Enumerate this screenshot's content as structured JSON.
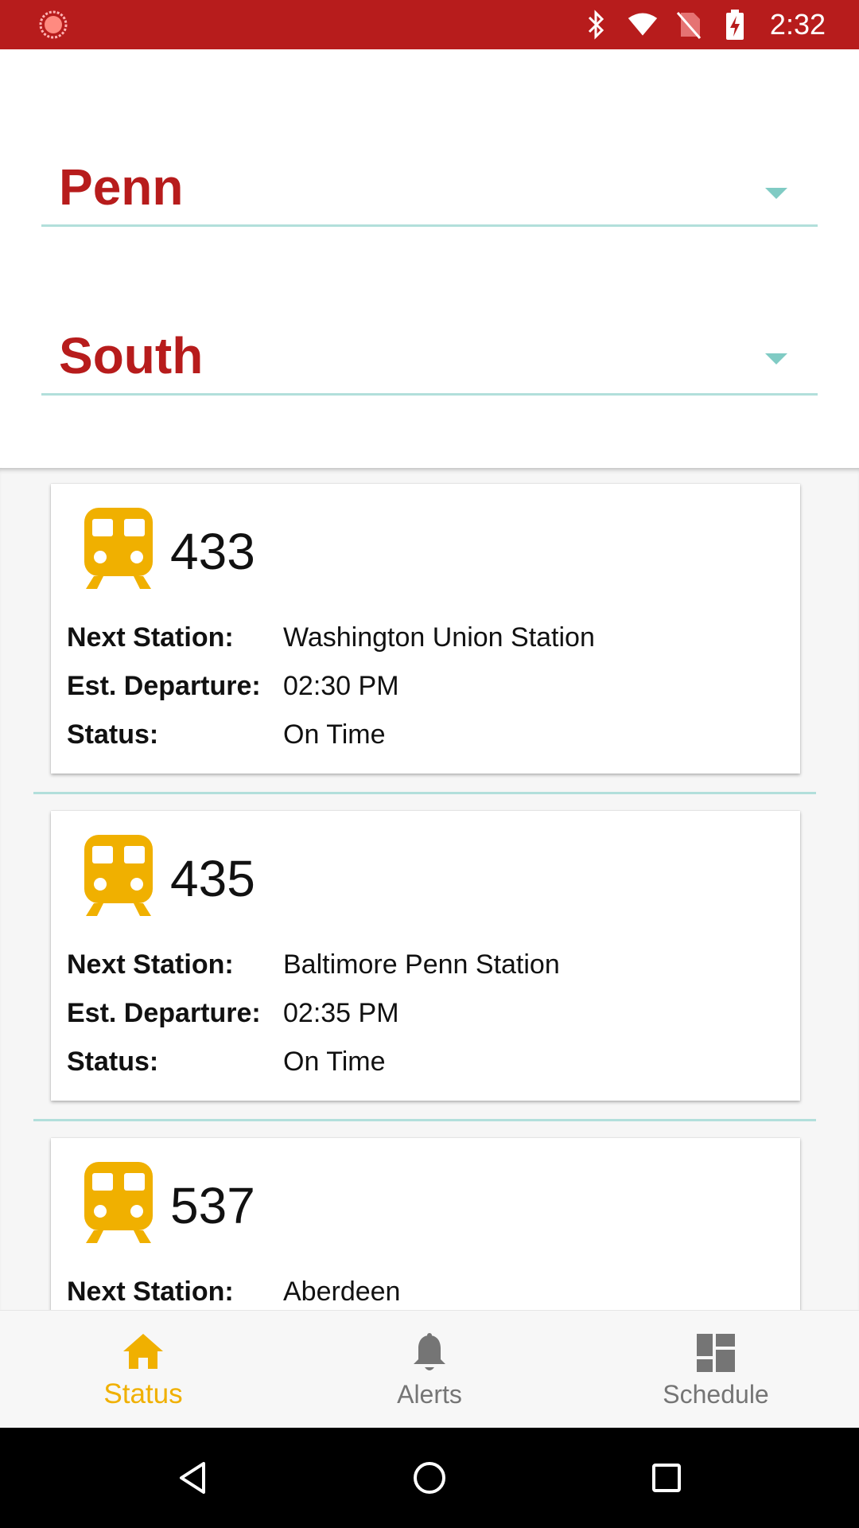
{
  "status_bar": {
    "time": "2:32",
    "icons": [
      "app-notification-icon",
      "bluetooth-icon",
      "wifi-icon",
      "no-sim-icon",
      "battery-charging-icon"
    ]
  },
  "selectors": {
    "station": {
      "value": "Penn"
    },
    "direction": {
      "value": "South"
    }
  },
  "labels": {
    "next_station": "Next Station:",
    "est_departure": "Est. Departure:",
    "status": "Status:"
  },
  "trains": [
    {
      "number": "433",
      "next_station": "Washington Union Station",
      "est_departure": "02:30 PM",
      "status": "On Time"
    },
    {
      "number": "435",
      "next_station": "Baltimore Penn Station",
      "est_departure": "02:35 PM",
      "status": "On Time"
    },
    {
      "number": "537",
      "next_station": "Aberdeen"
    }
  ],
  "bottom_nav": {
    "items": [
      {
        "label": "Status",
        "icon": "home-icon",
        "active": true
      },
      {
        "label": "Alerts",
        "icon": "bell-icon",
        "active": false
      },
      {
        "label": "Schedule",
        "icon": "dashboard-icon",
        "active": false
      }
    ]
  },
  "colors": {
    "brand_red": "#b71c1c",
    "accent_yellow": "#f0b000",
    "divider_teal": "#b2dfdb"
  }
}
